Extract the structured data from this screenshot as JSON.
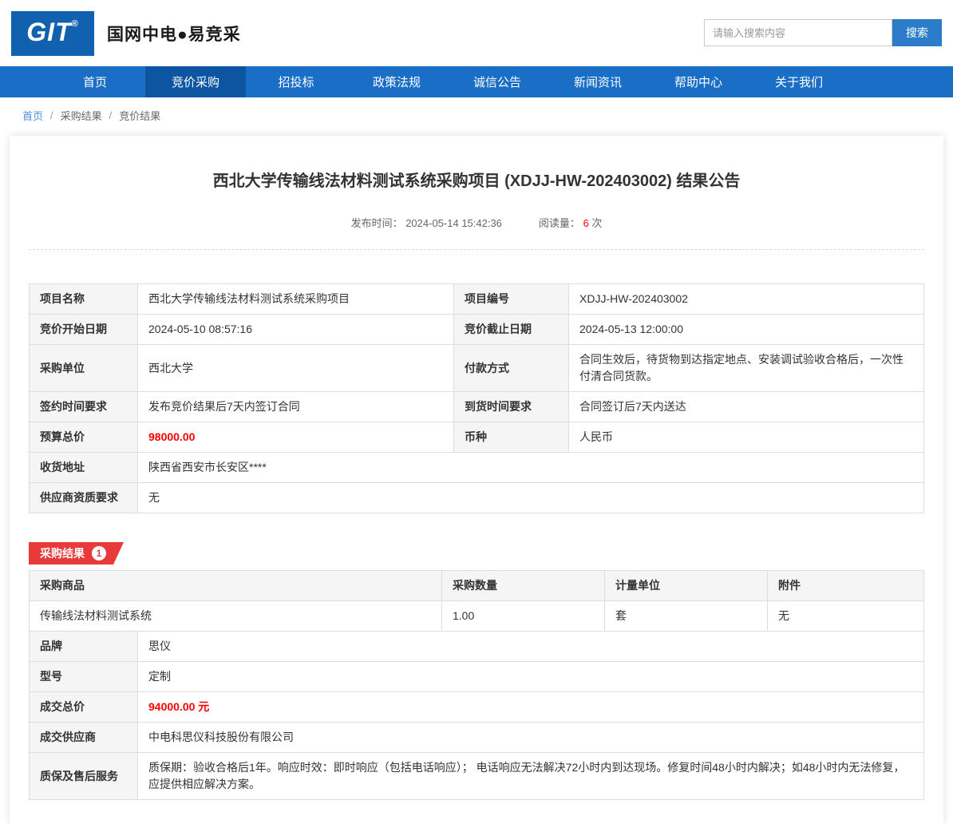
{
  "header": {
    "logo": "GIT",
    "logo_reg": "®",
    "site_title": "国网中电●易竞采",
    "search": {
      "placeholder": "请输入搜索内容",
      "button": "搜索"
    }
  },
  "nav": {
    "items": [
      {
        "label": "首页"
      },
      {
        "label": "竞价采购"
      },
      {
        "label": "招投标"
      },
      {
        "label": "政策法规"
      },
      {
        "label": "诚信公告"
      },
      {
        "label": "新闻资讯"
      },
      {
        "label": "帮助中心"
      },
      {
        "label": "关于我们"
      }
    ]
  },
  "breadcrumb": {
    "home": "首页",
    "sep": "/",
    "level1": "采购结果",
    "level2": "竞价结果"
  },
  "announcement": {
    "title": "西北大学传输线法材料测试系统采购项目 (XDJJ-HW-202403002) 结果公告",
    "publish_label": "发布时间：",
    "publish_time": "2024-05-14 15:42:36",
    "views_label": "阅读量：",
    "views": "6",
    "views_unit": "次"
  },
  "info": {
    "project_name_label": "项目名称",
    "project_name": "西北大学传输线法材料测试系统采购项目",
    "project_code_label": "项目编号",
    "project_code": "XDJJ-HW-202403002",
    "start_label": "竞价开始日期",
    "start": "2024-05-10 08:57:16",
    "end_label": "竞价截止日期",
    "end": "2024-05-13 12:00:00",
    "buyer_label": "采购单位",
    "buyer": "西北大学",
    "payment_label": "付款方式",
    "payment": "合同生效后，待货物到达指定地点、安装调试验收合格后，一次性付清合同货款。",
    "sign_label": "签约时间要求",
    "sign": "发布竞价结果后7天内签订合同",
    "delivery_label": "到货时间要求",
    "delivery": "合同签订后7天内送达",
    "budget_label": "预算总价",
    "budget": "98000.00",
    "currency_label": "币种",
    "currency": "人民币",
    "address_label": "收货地址",
    "address": "陕西省西安市长安区****",
    "qualification_label": "供应商资质要求",
    "qualification": "无"
  },
  "result": {
    "badge": "采购结果",
    "badge_num": "1",
    "columns": {
      "product": "采购商品",
      "qty": "采购数量",
      "unit": "计量单位",
      "attachment": "附件"
    },
    "row": {
      "product": "传输线法材料测试系统",
      "qty": "1.00",
      "unit": "套",
      "attachment": "无"
    },
    "brand_label": "品牌",
    "brand": "思仪",
    "model_label": "型号",
    "model": "定制",
    "deal_price_label": "成交总价",
    "deal_price": "94000.00",
    "deal_price_unit": "元",
    "supplier_label": "成交供应商",
    "supplier": "中电科思仪科技股份有限公司",
    "service_label": "质保及售后服务",
    "service": "质保期：验收合格后1年。响应时效：即时响应（包括电话响应）； 电话响应无法解决72小时内到达现场。修复时间48小时内解决；如48小时内无法修复，应提供相应解决方案。"
  }
}
